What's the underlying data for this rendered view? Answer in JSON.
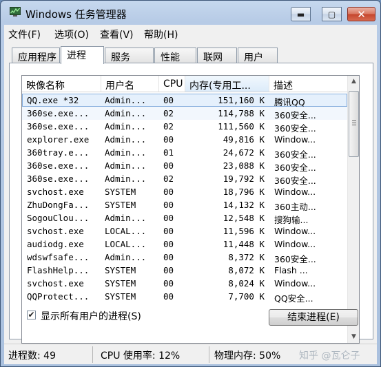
{
  "window": {
    "title": "Windows 任务管理器",
    "minimize_glyph": "▬",
    "maximize_glyph": "▢",
    "close_glyph": "✕"
  },
  "menu": {
    "items": [
      "文件(F)",
      "选项(O)",
      "查看(V)",
      "帮助(H)"
    ]
  },
  "tabs": [
    "应用程序",
    "进程",
    "服务",
    "性能",
    "联网",
    "用户"
  ],
  "active_tab": "进程",
  "table": {
    "headers": [
      "映像名称",
      "用户名",
      "CPU",
      "内存(专用工...",
      "描述"
    ],
    "rows": [
      {
        "name": "QQ.exe *32",
        "user": "Admin...",
        "cpu": "00",
        "mem": "151,160 K",
        "desc": "腾讯QQ"
      },
      {
        "name": "360se.exe...",
        "user": "Admin...",
        "cpu": "02",
        "mem": "114,788 K",
        "desc": "360安全..."
      },
      {
        "name": "360se.exe...",
        "user": "Admin...",
        "cpu": "02",
        "mem": "111,560 K",
        "desc": "360安全..."
      },
      {
        "name": "explorer.exe",
        "user": "Admin...",
        "cpu": "00",
        "mem": "49,816 K",
        "desc": "Window..."
      },
      {
        "name": "360tray.e...",
        "user": "Admin...",
        "cpu": "01",
        "mem": "24,672 K",
        "desc": "360安全..."
      },
      {
        "name": "360se.exe...",
        "user": "Admin...",
        "cpu": "00",
        "mem": "23,088 K",
        "desc": "360安全..."
      },
      {
        "name": "360se.exe...",
        "user": "Admin...",
        "cpu": "02",
        "mem": "19,792 K",
        "desc": "360安全..."
      },
      {
        "name": "svchost.exe",
        "user": "SYSTEM",
        "cpu": "00",
        "mem": "18,796 K",
        "desc": "Window..."
      },
      {
        "name": "ZhuDongFa...",
        "user": "SYSTEM",
        "cpu": "00",
        "mem": "14,132 K",
        "desc": "360主动..."
      },
      {
        "name": "SogouClou...",
        "user": "Admin...",
        "cpu": "00",
        "mem": "12,548 K",
        "desc": "搜狗输..."
      },
      {
        "name": "svchost.exe",
        "user": "LOCAL...",
        "cpu": "00",
        "mem": "11,596 K",
        "desc": "Window..."
      },
      {
        "name": "audiodg.exe",
        "user": "LOCAL...",
        "cpu": "00",
        "mem": "11,448 K",
        "desc": "Window..."
      },
      {
        "name": "wdswfsafe...",
        "user": "Admin...",
        "cpu": "00",
        "mem": "8,372 K",
        "desc": "360安全..."
      },
      {
        "name": "FlashHelp...",
        "user": "SYSTEM",
        "cpu": "00",
        "mem": "8,072 K",
        "desc": "Flash ..."
      },
      {
        "name": "svchost.exe",
        "user": "SYSTEM",
        "cpu": "00",
        "mem": "8,024 K",
        "desc": "Window..."
      },
      {
        "name": "QQProtect...",
        "user": "SYSTEM",
        "cpu": "00",
        "mem": "7,700 K",
        "desc": "QQ安全..."
      }
    ]
  },
  "show_all_users": {
    "label": "显示所有用户的进程(S)",
    "checked": true,
    "check_glyph": "✔"
  },
  "end_process_button": "结束进程(E)",
  "status": {
    "processes": "进程数: 49",
    "cpu": "CPU 使用率: 12%",
    "memory": "物理内存: 50%"
  },
  "watermark": "知乎 @瓦仑子"
}
